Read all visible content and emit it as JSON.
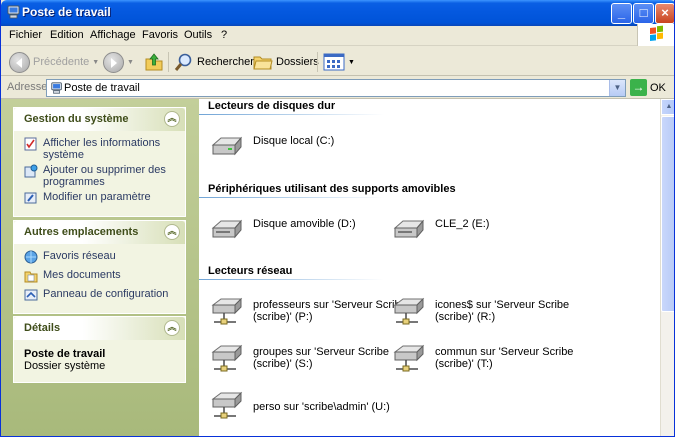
{
  "window": {
    "title": "Poste de travail",
    "controls": {
      "minimize": "_",
      "maximize": "□",
      "close": "×"
    }
  },
  "menu": [
    "Fichier",
    "Edition",
    "Affichage",
    "Favoris",
    "Outils",
    "?"
  ],
  "toolbar": {
    "back_label": "Précédente",
    "search_label": "Rechercher",
    "folders_label": "Dossiers"
  },
  "address": {
    "label": "Adresse",
    "value": "Poste de travail",
    "go_label": "OK"
  },
  "taskpane": {
    "system": {
      "title": "Gestion du système",
      "tasks": [
        {
          "label": "Afficher les informations système",
          "icon": "system-info-icon"
        },
        {
          "label": "Ajouter ou supprimer des programmes",
          "icon": "add-remove-programs-icon"
        },
        {
          "label": "Modifier un paramètre",
          "icon": "control-settings-icon"
        }
      ]
    },
    "places": {
      "title": "Autres emplacements",
      "tasks": [
        {
          "label": "Favoris réseau",
          "icon": "network-places-icon"
        },
        {
          "label": "Mes documents",
          "icon": "my-documents-icon"
        },
        {
          "label": "Panneau de configuration",
          "icon": "control-panel-icon"
        }
      ]
    },
    "details": {
      "title": "Détails",
      "name": "Poste de travail",
      "type": "Dossier système"
    }
  },
  "content": {
    "groups": [
      {
        "title": "Lecteurs de disques dur"
      },
      {
        "title": "Périphériques utilisant des supports amovibles"
      },
      {
        "title": "Lecteurs réseau"
      }
    ],
    "hard_drives": [
      {
        "label": "Disque local (C:)"
      }
    ],
    "removable": [
      {
        "label": "Disque amovible (D:)"
      },
      {
        "label": "CLE_2 (E:)"
      }
    ],
    "network": [
      {
        "line1": "professeurs sur 'Serveur Scribe",
        "line2": "(scribe)' (P:)"
      },
      {
        "line1": "icones$ sur 'Serveur Scribe",
        "line2": "(scribe)' (R:)"
      },
      {
        "line1": "groupes sur 'Serveur Scribe",
        "line2": "(scribe)' (S:)"
      },
      {
        "line1": "commun sur 'Serveur Scribe",
        "line2": "(scribe)' (T:)"
      },
      {
        "line1": "perso sur 'scribe\\admin' (U:)",
        "line2": ""
      }
    ]
  },
  "colors": {
    "titlebar": "#0053d8",
    "taskpane_bg": "#a8b97b",
    "panel_title": "#3f4d1a",
    "link": "#2b3a63"
  }
}
